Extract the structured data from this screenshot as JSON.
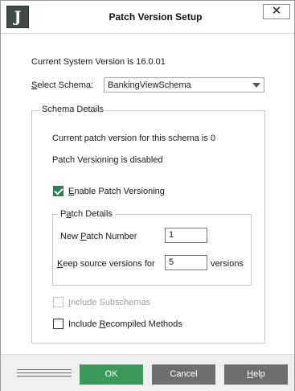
{
  "window": {
    "title": "Patch Version Setup",
    "app_icon_letter": "J",
    "close_glyph": "✕"
  },
  "system": {
    "version_text": "Current System Version is 16.0.01"
  },
  "schema": {
    "label_prefix": "",
    "label_mnemonic": "S",
    "label_rest": "elect Schema:",
    "selected": "BankingViewSchema"
  },
  "schema_details": {
    "legend": "Schema Details",
    "current_patch_text": "Current patch version for this schema is 0",
    "status_text": "Patch Versioning is disabled",
    "enable_checkbox": {
      "checked": true,
      "label_mnemonic": "E",
      "label_rest": "nable Patch Versioning"
    },
    "patch_details": {
      "legend_prefix": "P",
      "legend_mnemonic": "a",
      "legend_rest": "tch Details",
      "new_patch_label_prefix": "New ",
      "new_patch_label_mnemonic": "P",
      "new_patch_label_rest": "atch Number",
      "new_patch_value": "1",
      "keep_label_mnemonic": "K",
      "keep_label_rest": "eep source versions for",
      "keep_value": "5",
      "keep_suffix": "versions"
    },
    "include_subschemas": {
      "checked": false,
      "disabled": true,
      "label_mnemonic": "I",
      "label_rest": "nclude Subschemas"
    },
    "include_recompiled": {
      "checked": false,
      "label_prefix": "Include ",
      "label_mnemonic": "R",
      "label_rest": "ecompiled Methods"
    }
  },
  "buttons": {
    "ok": "OK",
    "cancel": "Cancel",
    "help_mnemonic": "H",
    "help_rest": "elp"
  },
  "colors": {
    "ok_button": "#3a9a5a",
    "gray_button": "#6e6e6e",
    "checkbox_checked": "#2e7d4f"
  }
}
